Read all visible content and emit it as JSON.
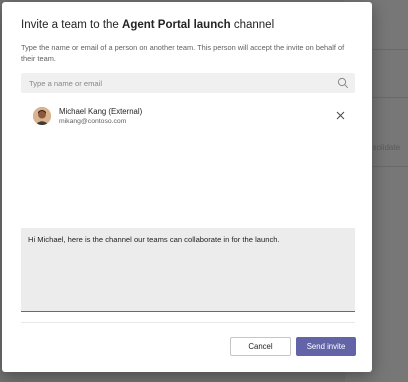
{
  "dialog": {
    "title_prefix": "Invite a team to the ",
    "title_channel": "Agent Portal launch",
    "title_suffix": " channel",
    "description": "Type the name or email of a person on another team. This person will accept the invite on behalf of their team.",
    "search": {
      "placeholder": "Type a name or email",
      "value": "",
      "icon": "search-icon"
    },
    "invitee": {
      "name": "Michael Kang (External)",
      "email": "mikang@contoso.com",
      "avatar": "avatar-photo",
      "remove_icon": "close-icon"
    },
    "message": "Hi Michael, here is the channel our teams can collaborate in for the launch.",
    "buttons": {
      "cancel_label": "Cancel",
      "send_label": "Send invite"
    }
  },
  "background": {
    "partial_text": "nsolidate"
  },
  "colors": {
    "accent": "#6264a7",
    "overlay": "#727272"
  }
}
